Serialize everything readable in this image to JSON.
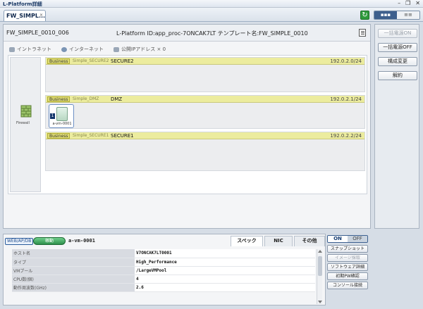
{
  "window": {
    "title": "L-Platform詳細",
    "controls": [
      "–",
      "❐",
      "✕"
    ]
  },
  "tab": {
    "label": "FW_SIMPL...",
    "close": "×"
  },
  "toolbar": {
    "refresh_icon": "↻",
    "view_toggle": [
      "▪▪▪",
      "≡≡"
    ]
  },
  "header": {
    "name": "FW_SIMPLE_0010_006",
    "detail": "L-Platform ID:app_proc-7ONCAK7LT  テンプレート名:FW_SIMPLE_0010"
  },
  "legend": [
    {
      "icon": "intranet-icon",
      "label": "イントラネット"
    },
    {
      "icon": "internet-icon",
      "label": "インターネット"
    },
    {
      "icon": "public-ip-icon",
      "label": "公開IPアドレス × 0"
    }
  ],
  "firewall": {
    "label": "Firewall"
  },
  "segments": [
    {
      "badge": "Business",
      "type": "Simple_SECURE2",
      "name": "SECURE2",
      "ip": "192.0.2.0/24"
    },
    {
      "badge": "Business",
      "type": "Simple_DMZ",
      "name": "DMZ",
      "ip": "192.0.2.1/24"
    },
    {
      "badge": "Business",
      "type": "Simple_SECURE1",
      "name": "SECURE1",
      "ip": "192.0.2.2/24"
    }
  ],
  "vm": {
    "index": "1",
    "label": "a-vm-0001"
  },
  "right_buttons": [
    {
      "label": "一括電源ON",
      "enabled": false
    },
    {
      "label": "一括電源OFF",
      "enabled": true
    },
    {
      "label": "構成変更",
      "enabled": true
    },
    {
      "label": "解約",
      "enabled": true
    }
  ],
  "detail": {
    "role_tag": "WEB/AP/DB",
    "status": "稼動",
    "vm_name": "a-vm-0001",
    "tabs": [
      "スペック",
      "NIC",
      "その他"
    ],
    "active_tab": "スペック",
    "properties": [
      {
        "key": "ホスト名",
        "value": "V7ONCAK7LT0001"
      },
      {
        "key": "タイプ",
        "value": "High_Performance"
      },
      {
        "key": "VMプール",
        "value": "/LargeVMPool"
      },
      {
        "key": "CPU数(個)",
        "value": "4"
      },
      {
        "key": "動作周波数(GHz)",
        "value": "2.6"
      }
    ]
  },
  "controls": {
    "on_label": "ON",
    "off_label": "OFF",
    "buttons": [
      {
        "label": "スナップショット",
        "enabled": true
      },
      {
        "label": "イメージ採取",
        "enabled": false
      },
      {
        "label": "ソフトウェア詳細",
        "enabled": true
      },
      {
        "label": "初期PW確認",
        "enabled": true
      },
      {
        "label": "コンソール接続",
        "enabled": true
      }
    ]
  }
}
